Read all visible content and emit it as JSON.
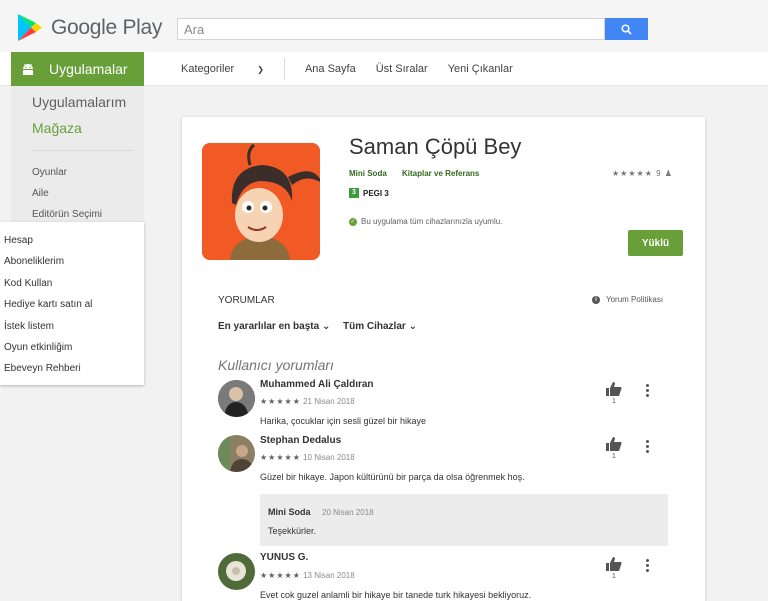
{
  "header": {
    "logo_text": "Google Play",
    "search_placeholder": "Ara",
    "search_icon": "search-icon"
  },
  "nav": {
    "apps_label": "Uygulamalar",
    "links": [
      "Kategoriler",
      "Ana Sayfa",
      "Üst Sıralar",
      "Yeni Çıkanlar"
    ]
  },
  "sidebar": {
    "my_apps": "Uygulamalarım",
    "store": "Mağaza",
    "categories": [
      "Oyunlar",
      "Aile",
      "Editörün Seçimi"
    ],
    "account_items": [
      "Hesap",
      "Aboneliklerim",
      "Kod Kullan",
      "Hediye kartı satın al",
      "İstek listem",
      "Oyun etkinliğim",
      "Ebeveyn Rehberi"
    ]
  },
  "app": {
    "title": "Saman Çöpü Bey",
    "developer": "Mini Soda",
    "genre": "Kitaplar ve Referans",
    "pegi_number": "3",
    "pegi_label": "PEGI 3",
    "rating_stars": "★★★★★",
    "rating_count": "9",
    "compat_text": "Bu uygulama tüm cihazlarınızla uyumlu.",
    "installed_label": "Yüklü"
  },
  "reviews": {
    "heading": "YORUMLAR",
    "policy": "Yorum Politikası",
    "sort": "En yararlılar en başta",
    "device": "Tüm Cihazlar",
    "user_reviews_title": "Kullanıcı yorumları",
    "items": [
      {
        "name": "Muhammed Ali Çaldıran",
        "stars": "★★★★★",
        "date": "21 Nisan 2018",
        "text": "Harika, çocuklar için sesli güzel bir hikaye",
        "helpful": "1"
      },
      {
        "name": "Stephan Dedalus",
        "stars": "★★★★★",
        "date": "10 Nisan 2018",
        "text": "Güzel bir hikaye. Japon kültürünü bir parça da olsa öğrenmek hoş.",
        "helpful": "1"
      },
      {
        "name": "YUNUS G.",
        "stars": "★★★★★",
        "date": "13 Nisan 2018",
        "text": "Evet cok guzel anlamli bir hikaye bir tanede turk hikayesi bekliyoruz.",
        "helpful": "1"
      }
    ],
    "reply": {
      "name": "Mini Soda",
      "date": "20 Nisan 2018",
      "text": "Teşekkürler."
    }
  },
  "colors": {
    "accent": "#689f38",
    "search": "#4285f4",
    "icon_bg": "#f15a24"
  }
}
